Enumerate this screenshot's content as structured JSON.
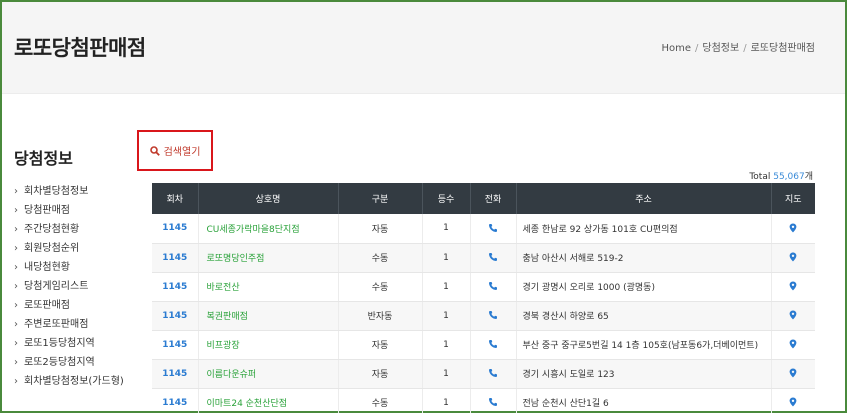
{
  "header": {
    "title": "로또당첨판매점",
    "breadcrumb": [
      "Home",
      "당첨정보",
      "로또당첨판매점"
    ]
  },
  "sidebar": {
    "title": "당첨정보",
    "items": [
      {
        "label": "회차별당첨정보"
      },
      {
        "label": "당첨판매점"
      },
      {
        "label": "주간당첨현황"
      },
      {
        "label": "회원당첨순위"
      },
      {
        "label": "내당첨현황"
      },
      {
        "label": "당첨게임리스트"
      },
      {
        "label": "로또판매점"
      },
      {
        "label": "주변로또판매점"
      },
      {
        "label": "로또1등당첨지역"
      },
      {
        "label": "로또2등당첨지역"
      },
      {
        "label": "회차별당첨정보(가드형)"
      }
    ]
  },
  "search": {
    "label": "검색열기",
    "icon": "search-icon"
  },
  "total": {
    "prefix": "Total",
    "count": "55,067",
    "suffix": "개"
  },
  "table": {
    "headers": [
      "회차",
      "상호명",
      "구분",
      "등수",
      "전화",
      "주소",
      "지도"
    ],
    "rows": [
      {
        "round": "1145",
        "name": "CU세종가락마을8단지점",
        "type": "자동",
        "rank": "1",
        "address": "세종 한남로 92 상가동 101호 CU편의점"
      },
      {
        "round": "1145",
        "name": "로또명당인주점",
        "type": "수동",
        "rank": "1",
        "address": "충남 아산시 서해로 519-2"
      },
      {
        "round": "1145",
        "name": "바로전산",
        "type": "수동",
        "rank": "1",
        "address": "경기 광명시 오리로 1000 (광명동)"
      },
      {
        "round": "1145",
        "name": "복권판매점",
        "type": "반자동",
        "rank": "1",
        "address": "경북 경산시 하양로 65"
      },
      {
        "round": "1145",
        "name": "비프광장",
        "type": "자동",
        "rank": "1",
        "address": "부산 중구 중구로5번길 14 1층 105호(남포동6가,더베이먼트)"
      },
      {
        "round": "1145",
        "name": "이름다운슈퍼",
        "type": "자동",
        "rank": "1",
        "address": "경기 시흥시 도일로 123"
      },
      {
        "round": "1145",
        "name": "이마트24 순천산단점",
        "type": "수동",
        "rank": "1",
        "address": "전남 순천시 산단1길 6"
      }
    ]
  },
  "colors": {
    "accent_blue": "#2a7bd1",
    "name_green": "#2aa23a",
    "header_dark": "#333b42",
    "highlight_red": "#d9161b"
  }
}
